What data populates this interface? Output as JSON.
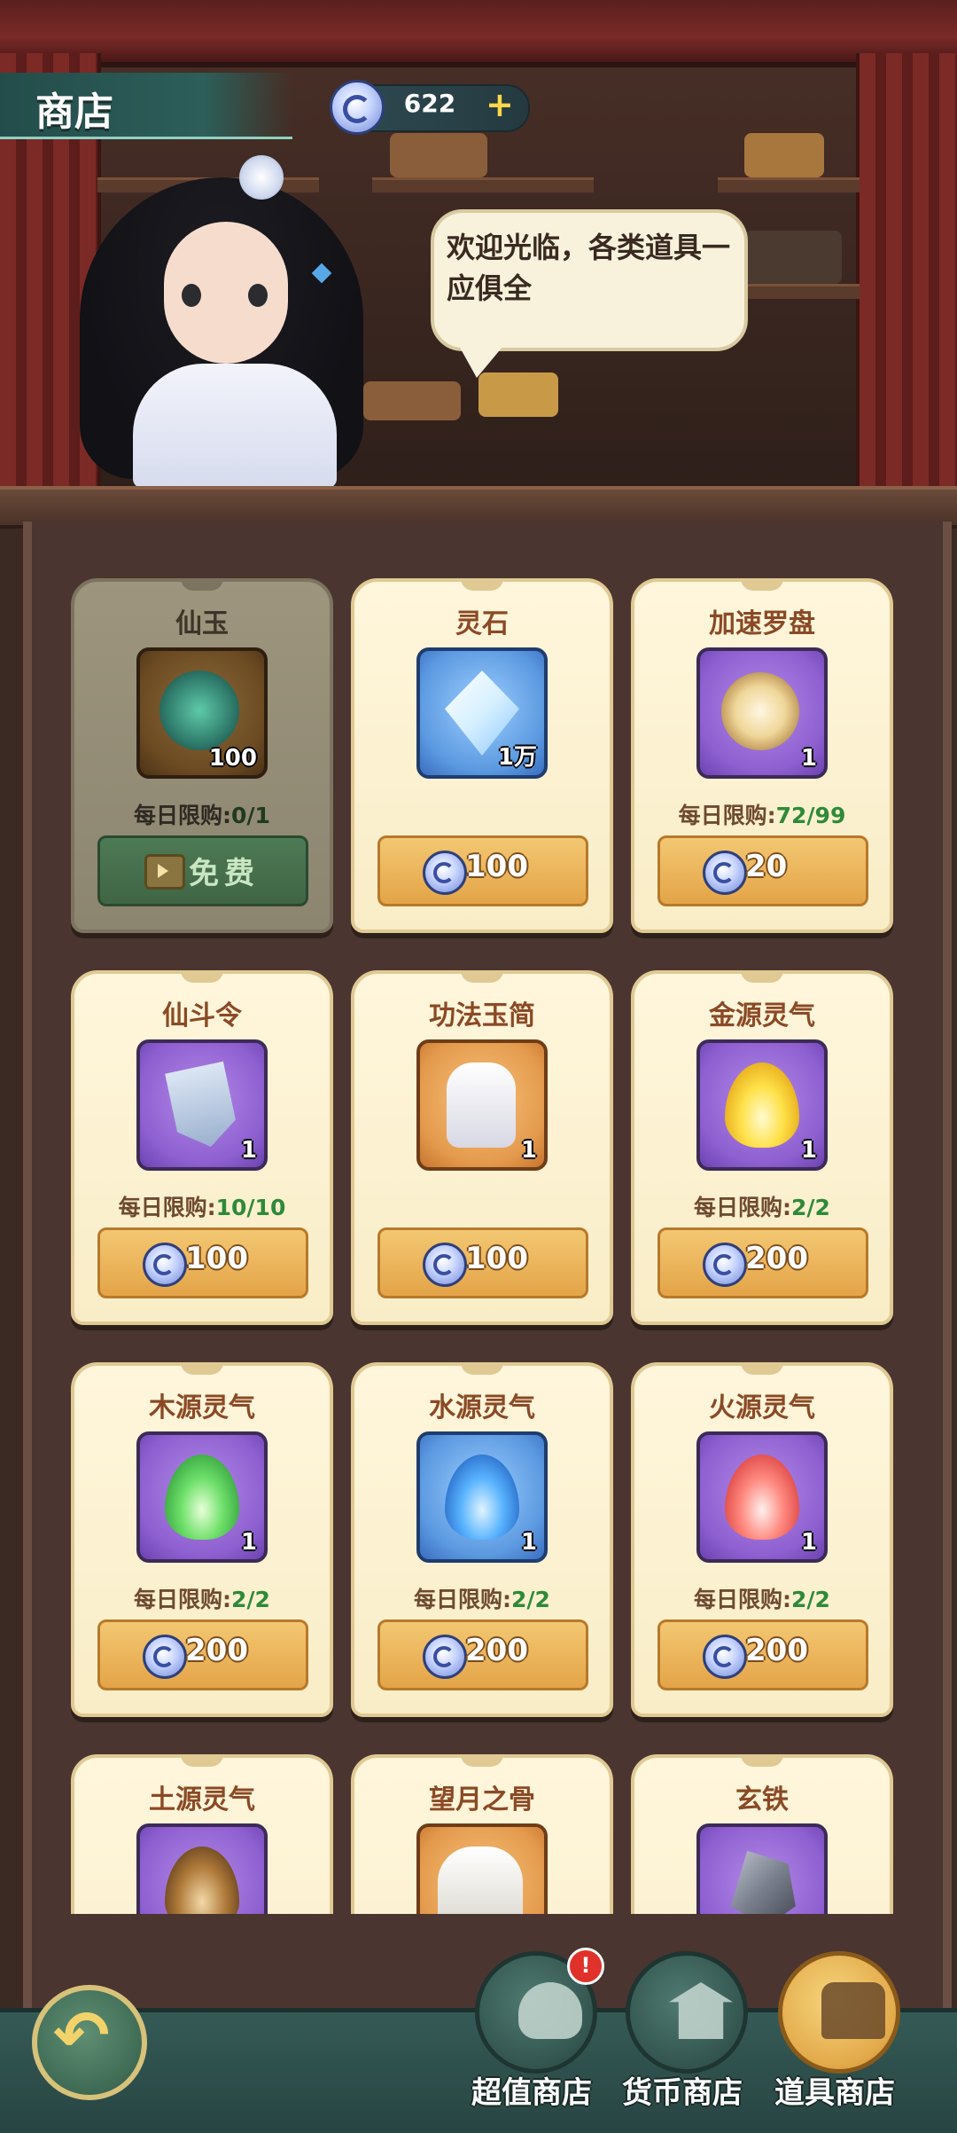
{
  "header": {
    "title": "商店",
    "currency": {
      "icon": "spirit-coin-icon",
      "value": "622",
      "plus": "+"
    }
  },
  "npc": {
    "speech": "欢迎光临，各类道具一应俱全"
  },
  "items": [
    {
      "name": "仙玉",
      "qty": "100",
      "icon": "jade-coin-icon",
      "limit_label": "每日限购:",
      "limit_value": "0/1",
      "price": "",
      "free_label": "免费",
      "disabled": true
    },
    {
      "name": "灵石",
      "qty": "1万",
      "icon": "crystal-icon",
      "limit_label": "",
      "limit_value": "",
      "price": "100",
      "disabled": false
    },
    {
      "name": "加速罗盘",
      "qty": "1",
      "icon": "compass-icon",
      "limit_label": "每日限购:",
      "limit_value": "72/99",
      "price": "20",
      "disabled": false
    },
    {
      "name": "仙斗令",
      "qty": "1",
      "icon": "battle-token-icon",
      "limit_label": "每日限购:",
      "limit_value": "10/10",
      "price": "100",
      "disabled": false
    },
    {
      "name": "功法玉简",
      "qty": "1",
      "icon": "skill-scroll-icon",
      "limit_label": "",
      "limit_value": "",
      "price": "100",
      "disabled": false
    },
    {
      "name": "金源灵气",
      "qty": "1",
      "icon": "gold-flame-icon",
      "limit_label": "每日限购:",
      "limit_value": "2/2",
      "price": "200",
      "disabled": false
    },
    {
      "name": "木源灵气",
      "qty": "1",
      "icon": "green-flame-icon",
      "limit_label": "每日限购:",
      "limit_value": "2/2",
      "price": "200",
      "disabled": false
    },
    {
      "name": "水源灵气",
      "qty": "1",
      "icon": "blue-flame-icon",
      "limit_label": "每日限购:",
      "limit_value": "2/2",
      "price": "200",
      "disabled": false
    },
    {
      "name": "火源灵气",
      "qty": "1",
      "icon": "red-flame-icon",
      "limit_label": "每日限购:",
      "limit_value": "2/2",
      "price": "200",
      "disabled": false
    },
    {
      "name": "土源灵气",
      "qty": "",
      "icon": "earth-flame-icon",
      "limit_label": "",
      "limit_value": "",
      "price": "",
      "disabled": false
    },
    {
      "name": "望月之骨",
      "qty": "",
      "icon": "bone-icon",
      "limit_label": "",
      "limit_value": "",
      "price": "",
      "disabled": false
    },
    {
      "name": "玄铁",
      "qty": "",
      "icon": "iron-ore-icon",
      "limit_label": "",
      "limit_value": "",
      "price": "",
      "disabled": false
    }
  ],
  "tabs": [
    {
      "label": "超值商店",
      "icon": "pouch-icon",
      "badge": "!",
      "active": false
    },
    {
      "label": "货币商店",
      "icon": "pavilion-icon",
      "badge": "",
      "active": false
    },
    {
      "label": "道具商店",
      "icon": "treasure-chest-icon",
      "badge": "",
      "active": true
    }
  ],
  "colors": {
    "accent_gold": "#e4a448",
    "limit_green": "#2e8a3a",
    "header_teal": "#2d5e59"
  }
}
